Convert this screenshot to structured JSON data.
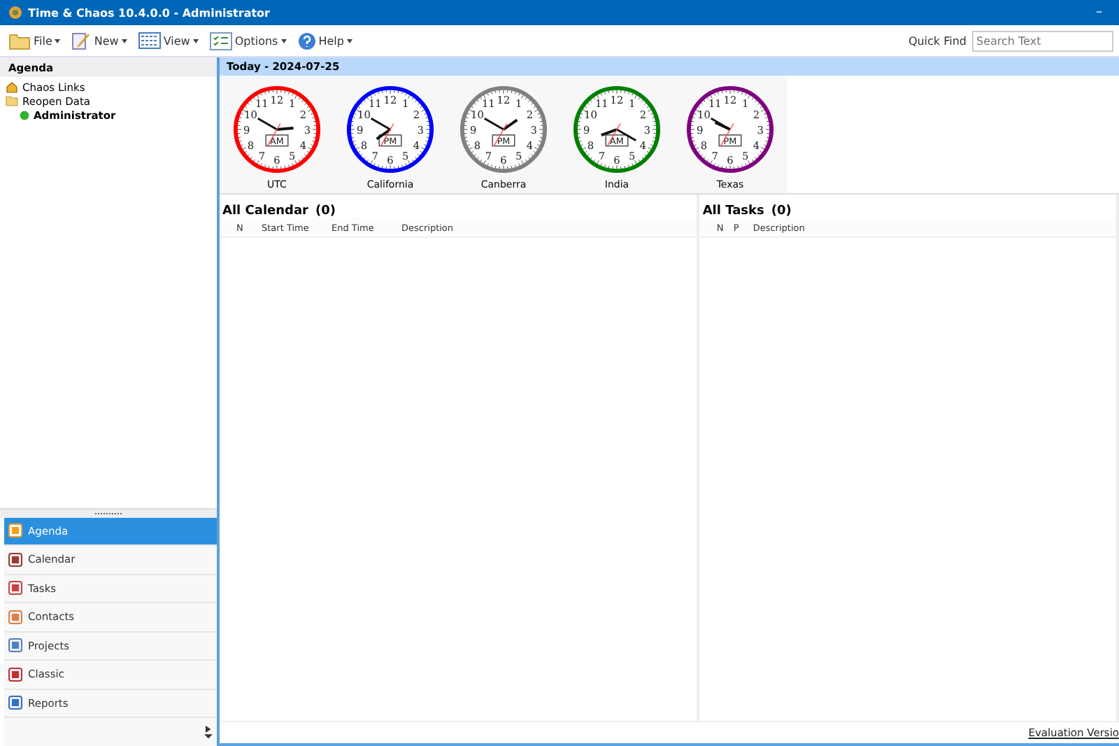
{
  "window": {
    "title": "Time & Chaos 10.4.0.0 - Administrator",
    "controls": [
      "–"
    ]
  },
  "toolbar": {
    "menus": [
      {
        "label": "File"
      },
      {
        "label": "New"
      },
      {
        "label": "View"
      },
      {
        "label": "Options"
      },
      {
        "label": "Help"
      }
    ],
    "quick_find": {
      "label": "Quick Find",
      "placeholder": "Search Text"
    }
  },
  "sidebar": {
    "title": "Agenda",
    "tree": [
      {
        "label": "Chaos Links"
      },
      {
        "label": "Reopen Data",
        "children": [
          {
            "label": "Administrator"
          }
        ]
      }
    ],
    "nav": [
      {
        "label": "Agenda",
        "selected": true
      },
      {
        "label": "Calendar",
        "selected": false
      },
      {
        "label": "Tasks",
        "selected": false
      },
      {
        "label": "Contacts",
        "selected": false
      },
      {
        "label": "Projects",
        "selected": false
      },
      {
        "label": "Classic",
        "selected": false
      },
      {
        "label": "Reports",
        "selected": false
      }
    ]
  },
  "today": {
    "title": "Today - 2024-07-25",
    "clocks": [
      {
        "name": "UTC",
        "color": "#ff0000",
        "meridiem": "AM",
        "numerals": [
          "12",
          "11",
          "1",
          "10",
          "2",
          "9",
          "3",
          "8",
          "4",
          "7",
          "5",
          "6"
        ]
      },
      {
        "name": "California",
        "color": "#0000ff",
        "meridiem": "PM",
        "numerals": [
          "12",
          "11",
          "1",
          "10",
          "2",
          "9",
          "3",
          "8",
          "4",
          "7",
          "5",
          "6"
        ]
      },
      {
        "name": "Canberra",
        "color": "#808080",
        "meridiem": "PM",
        "numerals": [
          "12",
          "11",
          "1",
          "10",
          "2",
          "9",
          "3",
          "8",
          "4",
          "7",
          "5",
          "6"
        ]
      },
      {
        "name": "India",
        "color": "#008000",
        "meridiem": "AM",
        "numerals": [
          "12",
          "11",
          "1",
          "10",
          "2",
          "9",
          "3",
          "8",
          "4",
          "7",
          "5",
          "6"
        ]
      },
      {
        "name": "Texas",
        "color": "#800080",
        "meridiem": "PM",
        "numerals": [
          "12",
          "11",
          "1",
          "10",
          "2",
          "9",
          "3",
          "8",
          "4",
          "7",
          "5",
          "6"
        ]
      }
    ]
  },
  "calendar": {
    "title": "All Calendar",
    "count": "(0)",
    "columns": [
      "N",
      "Start Time",
      "End Time",
      "Description"
    ]
  },
  "tasks": {
    "title": "All Tasks",
    "count": "(0)",
    "columns": [
      "N",
      "P",
      "Description"
    ]
  },
  "status_bar": {
    "link": "Evaluation Versio"
  }
}
